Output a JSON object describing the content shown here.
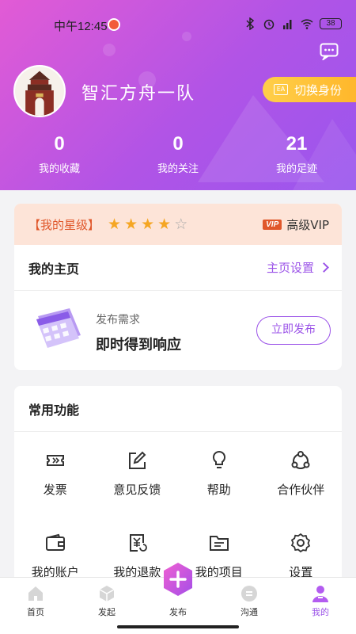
{
  "status_bar": {
    "time": "中午12:45",
    "battery": "38"
  },
  "profile": {
    "name": "智汇方舟一队",
    "switch_label": "切换身份",
    "stats": [
      {
        "value": "0",
        "label": "我的收藏"
      },
      {
        "value": "0",
        "label": "我的关注"
      },
      {
        "value": "21",
        "label": "我的足迹"
      }
    ]
  },
  "vip": {
    "level_label": "【我的星级】",
    "stars_filled": 4,
    "stars_total": 5,
    "badge": "VIP",
    "vip_label": "高级VIP"
  },
  "homepage": {
    "title": "我的主页",
    "settings_label": "主页设置"
  },
  "publish_card": {
    "subtitle": "发布需求",
    "title": "即时得到响应",
    "button": "立即发布"
  },
  "functions": {
    "title": "常用功能",
    "items": [
      {
        "label": "发票",
        "icon": "ticket-icon"
      },
      {
        "label": "意见反馈",
        "icon": "edit-icon"
      },
      {
        "label": "帮助",
        "icon": "lightbulb-icon"
      },
      {
        "label": "合作伙伴",
        "icon": "partner-icon"
      },
      {
        "label": "我的账户",
        "icon": "wallet-icon"
      },
      {
        "label": "我的退款",
        "icon": "refund-icon"
      },
      {
        "label": "我的项目",
        "icon": "folder-icon"
      },
      {
        "label": "设置",
        "icon": "gear-icon"
      }
    ]
  },
  "tabbar": {
    "items": [
      {
        "label": "首页",
        "icon": "home-icon"
      },
      {
        "label": "发起",
        "icon": "cube-icon"
      },
      {
        "label": "发布",
        "icon": "plus-icon"
      },
      {
        "label": "沟通",
        "icon": "chat-icon"
      },
      {
        "label": "我的",
        "icon": "user-icon"
      }
    ],
    "active": "我的"
  },
  "colors": {
    "accent": "#9b53e8",
    "header_gradient_start": "#e25bd5",
    "header_gradient_end": "#9a56ee",
    "switch_button": "#ffbf35",
    "star": "#f5a623",
    "vip_bar": "#fde4d8"
  }
}
